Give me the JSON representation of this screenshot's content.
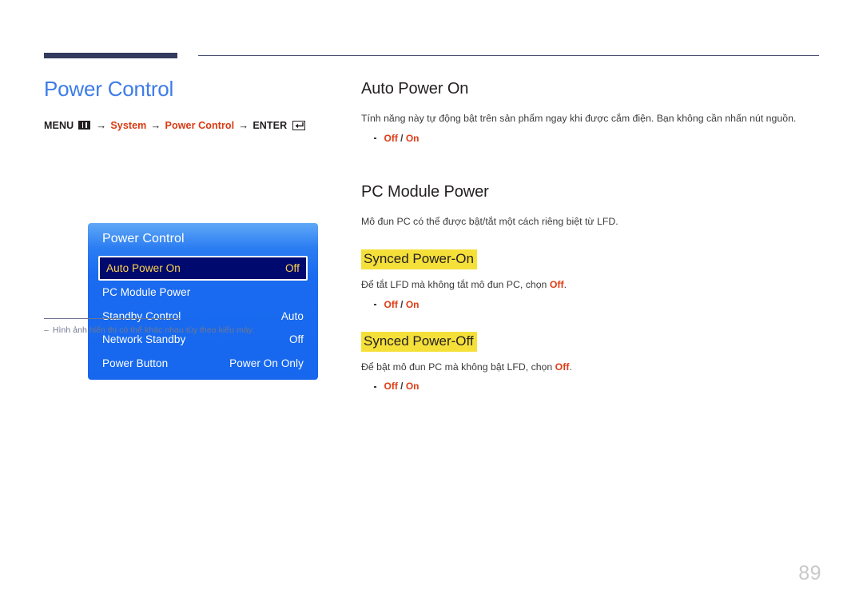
{
  "header": {
    "rule_color": "#343b5e"
  },
  "left": {
    "page_title": "Power Control",
    "breadcrumb": {
      "menu_label": "MENU",
      "menu_icon": "menu-grid-icon",
      "arrow": "→",
      "step1": "System",
      "step2": "Power Control",
      "enter_label": "ENTER",
      "enter_icon": "enter-return-icon"
    },
    "osd": {
      "title": "Power Control",
      "rows": [
        {
          "label": "Auto Power On",
          "value": "Off",
          "selected": true
        },
        {
          "label": "PC Module Power",
          "value": "",
          "selected": false
        },
        {
          "label": "Standby Control",
          "value": "Auto",
          "selected": false
        },
        {
          "label": "Network Standby",
          "value": "Off",
          "selected": false
        },
        {
          "label": "Power Button",
          "value": "Power On Only",
          "selected": false
        }
      ]
    },
    "footnote": {
      "dash": "–",
      "text": "Hình ảnh hiển thị có thể khác nhau tùy theo kiểu máy."
    }
  },
  "right": {
    "section1": {
      "heading": "Auto Power On",
      "body": "Tính năng này tự động bật trên sản phẩm ngay khi được cắm điện. Bạn không cần nhấn nút nguồn.",
      "option_off": "Off",
      "option_sep": " / ",
      "option_on": "On"
    },
    "section2": {
      "heading": "PC Module Power",
      "body": "Mô đun PC có thể được bật/tắt một cách riêng biệt từ LFD.",
      "sub1": {
        "heading": "Synced Power-On",
        "text_before": "Để tắt LFD mà không tắt mô đun PC, chọn ",
        "text_red": "Off",
        "text_after": ".",
        "option_off": "Off",
        "option_sep": " / ",
        "option_on": "On"
      },
      "sub2": {
        "heading": "Synced Power-Off",
        "text_before": "Để bật mô đun PC mà không bật LFD, chọn ",
        "text_red": "Off",
        "text_after": ".",
        "option_off": "Off",
        "option_sep": " / ",
        "option_on": "On"
      }
    }
  },
  "page_number": "89"
}
